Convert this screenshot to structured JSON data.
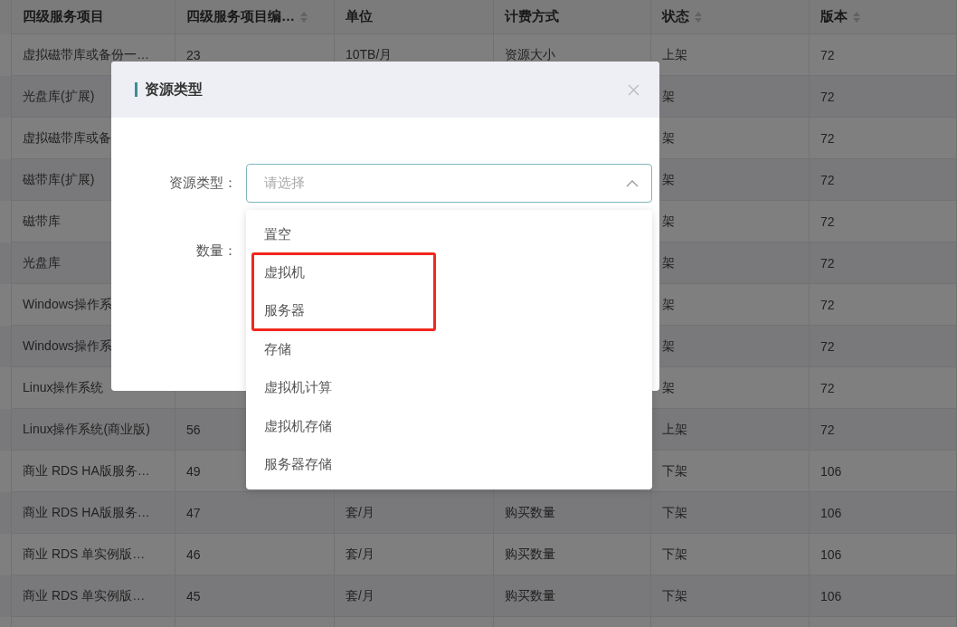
{
  "table": {
    "columns": [
      {
        "label": "四级服务项目",
        "sortable": false
      },
      {
        "label": "四级服务项目编…",
        "sortable": true
      },
      {
        "label": "单位",
        "sortable": false
      },
      {
        "label": "计费方式",
        "sortable": false
      },
      {
        "label": "状态",
        "sortable": true
      },
      {
        "label": "版本",
        "sortable": true
      }
    ],
    "rows": [
      {
        "item": "虚拟磁带库或备份一…",
        "code": "23",
        "unit": "10TB/月",
        "billing": "资源大小",
        "status": "上架",
        "version": "72"
      },
      {
        "item": "光盘库(扩展)",
        "status": "架",
        "version": "72"
      },
      {
        "item": "虚拟磁带库或备",
        "status": "架",
        "version": "72"
      },
      {
        "item": "磁带库(扩展)",
        "status": "架",
        "version": "72"
      },
      {
        "item": "磁带库",
        "status": "架",
        "version": "72"
      },
      {
        "item": "光盘库",
        "status": "架",
        "version": "72"
      },
      {
        "item": "Windows操作系",
        "status": "架",
        "version": "72"
      },
      {
        "item": "Windows操作系",
        "status": "架",
        "version": "72"
      },
      {
        "item": "Linux操作系统",
        "status": "架",
        "version": "72"
      },
      {
        "item": "Linux操作系统(商业版)",
        "code": "56",
        "status": "上架",
        "version": "72"
      },
      {
        "item": "商业 RDS HA版服务…",
        "code": "49",
        "status": "下架",
        "version": "106"
      },
      {
        "item": "商业 RDS HA版服务…",
        "code": "47",
        "unit": "套/月",
        "billing": "购买数量",
        "status": "下架",
        "version": "106"
      },
      {
        "item": "商业 RDS 单实例版…",
        "code": "46",
        "unit": "套/月",
        "billing": "购买数量",
        "status": "下架",
        "version": "106"
      },
      {
        "item": "商业 RDS 单实例版…",
        "code": "45",
        "unit": "套/月",
        "billing": "购买数量",
        "status": "下架",
        "version": "106"
      },
      {}
    ]
  },
  "dialog": {
    "title": "资源类型",
    "fields": [
      {
        "kind": "select",
        "label": "资源类型：",
        "placeholder": "请选择",
        "expanded": true,
        "options": [
          {
            "label": "置空",
            "highlighted": false
          },
          {
            "label": "虚拟机",
            "highlighted": true
          },
          {
            "label": "服务器",
            "highlighted": true
          },
          {
            "label": "存储",
            "highlighted": false
          },
          {
            "label": "虚拟机计算",
            "highlighted": false
          },
          {
            "label": "虚拟机存储",
            "highlighted": false
          },
          {
            "label": "服务器存储",
            "highlighted": false
          }
        ]
      },
      {
        "kind": "input",
        "label": "数量："
      }
    ]
  }
}
